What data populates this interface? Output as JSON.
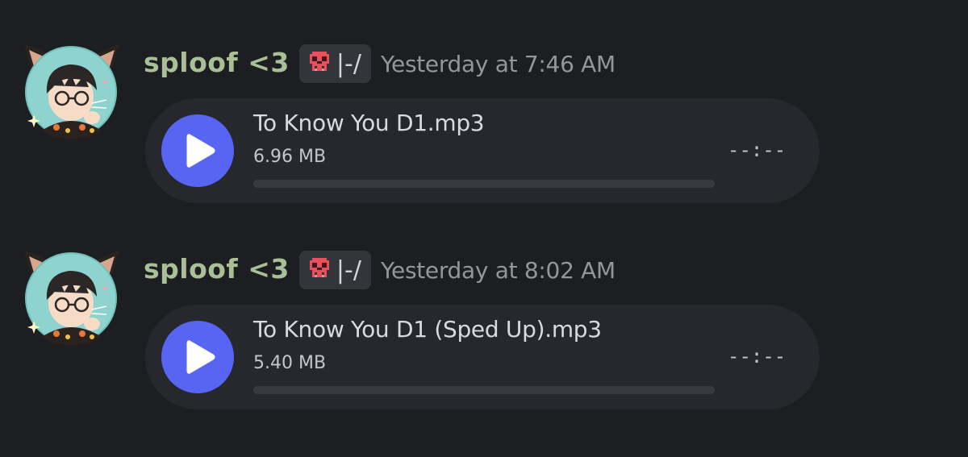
{
  "messages": [
    {
      "author": "sploof <3",
      "tag": {
        "icon": "skull-icon",
        "icon_color": "#e8515c",
        "text": "|-/"
      },
      "timestamp": "Yesterday at 7:46 AM",
      "attachment": {
        "file_name": "To Know You D1.mp3",
        "file_size": "6.96 MB",
        "duration": "--:--",
        "progress": 0
      }
    },
    {
      "author": "sploof <3",
      "tag": {
        "icon": "skull-icon",
        "icon_color": "#e8515c",
        "text": "|-/"
      },
      "timestamp": "Yesterday at 8:02 AM",
      "attachment": {
        "file_name": "To Know You D1 (Sped Up).mp3",
        "file_size": "5.40 MB",
        "duration": "--:--",
        "progress": 0
      }
    }
  ],
  "colors": {
    "background": "#1d1e22",
    "card": "#27282e",
    "accent": "#5865f2",
    "username": "#a9c096",
    "timestamp": "#94969c"
  }
}
